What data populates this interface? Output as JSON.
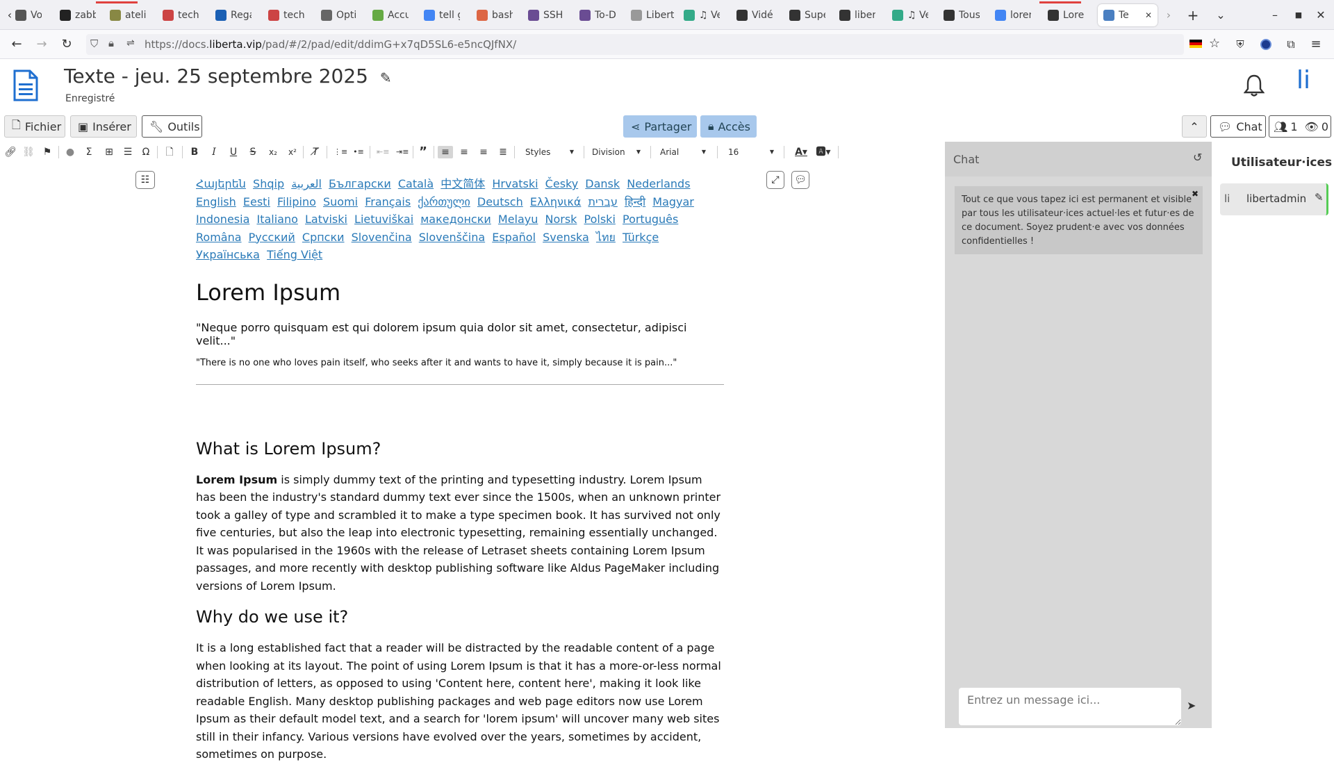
{
  "browser": {
    "tabs": [
      {
        "label": "Vork",
        "color": "#555"
      },
      {
        "label": "zabb",
        "color": "#222"
      },
      {
        "label": "ateli",
        "color": "#884"
      },
      {
        "label": "tech",
        "color": "#c44"
      },
      {
        "label": "Rega",
        "color": "#1a5fb4"
      },
      {
        "label": "tech",
        "color": "#c44"
      },
      {
        "label": "Optio",
        "color": "#666"
      },
      {
        "label": "Accu",
        "color": "#6a4"
      },
      {
        "label": "tell g",
        "color": "#4285f4"
      },
      {
        "label": "bash",
        "color": "#d64"
      },
      {
        "label": "SSH",
        "color": "#6a4c93"
      },
      {
        "label": "To-D",
        "color": "#6a4c93"
      },
      {
        "label": "Liberta",
        "color": "#999"
      },
      {
        "label": "♫ Ve",
        "color": "#3a8"
      },
      {
        "label": "Vidé",
        "color": "#333"
      },
      {
        "label": "Supe",
        "color": "#333"
      },
      {
        "label": "libert",
        "color": "#333"
      },
      {
        "label": "♫ Ve",
        "color": "#3a8"
      },
      {
        "label": "Tous",
        "color": "#333"
      },
      {
        "label": "loren",
        "color": "#4285f4"
      },
      {
        "label": "Lore",
        "color": "#333"
      },
      {
        "label": "Te",
        "color": "#4a7fc1"
      }
    ],
    "url_prefix": "https://docs.",
    "url_domain": "liberta.vip",
    "url_rest": "/pad/#/2/pad/edit/ddimG+x7qD5SL6-e5ncQJfNX/"
  },
  "app": {
    "title": "Texte - jeu. 25 septembre 2025",
    "status": "Enregistré",
    "user_initials": "li"
  },
  "toolbar": {
    "fichier": "Fichier",
    "inserer": "Insérer",
    "outils": "Outils",
    "partager": "Partager",
    "acces": "Accès",
    "chat": "Chat",
    "users_count": "1",
    "viewers_count": "0"
  },
  "format": {
    "styles": "Styles",
    "division": "Division",
    "font": "Arial",
    "size": "16"
  },
  "document": {
    "languages": [
      "Հայերեն",
      "Shqip",
      "العربية",
      "Български",
      "Català",
      "中文简体",
      "Hrvatski",
      "Česky",
      "Dansk",
      "Nederlands",
      "English",
      "Eesti",
      "Filipino",
      "Suomi",
      "Français",
      "ქართული",
      "Deutsch",
      "Ελληνικά",
      "עברית",
      "हिन्दी",
      "Magyar",
      "Indonesia",
      "Italiano",
      "Latviski",
      "Lietuviškai",
      "македонски",
      "Melayu",
      "Norsk",
      "Polski",
      "Português",
      "Româna",
      "Русский",
      "Српски",
      "Slovenčina",
      "Slovenščina",
      "Español",
      "Svenska",
      "ไทย",
      "Türkçe",
      "Українська",
      "Tiếng Việt"
    ],
    "heading": "Lorem Ipsum",
    "quote1": "\"Neque porro quisquam est qui dolorem ipsum quia dolor sit amet, consectetur, adipisci velit...\"",
    "quote2": "\"There is no one who loves pain itself, who seeks after it and wants to have it, simply because it is pain...\"",
    "h2_what": "What is Lorem Ipsum?",
    "what_bold": "Lorem Ipsum",
    "what_text": " is simply dummy text of the printing and typesetting industry. Lorem Ipsum has been the industry's standard dummy text ever since the 1500s, when an unknown printer took a galley of type and scrambled it to make a type specimen book. It has survived not only five centuries, but also the leap into electronic typesetting, remaining essentially unchanged. It was popularised in the 1960s with the release of Letraset sheets containing Lorem Ipsum passages, and more recently with desktop publishing software like Aldus PageMaker including versions of Lorem Ipsum.",
    "h2_why": "Why do we use it?",
    "why_text": "It is a long established fact that a reader will be distracted by the readable content of a page when looking at its layout. The point of using Lorem Ipsum is that it has a more-or-less normal distribution of letters, as opposed to using 'Content here, content here', making it look like readable English. Many desktop publishing packages and web page editors now use Lorem Ipsum as their default model text, and a search for 'lorem ipsum' will uncover many web sites still in their infancy. Various versions have evolved over the years, sometimes by accident, sometimes on purpose."
  },
  "chat": {
    "title": "Chat",
    "notice": "Tout ce que vous tapez ici est permanent et visible par tous les utilisateur·ices actuel·les et futur·es de ce document. Soyez prudent·e avec vos données confidentielles !",
    "input_placeholder": "Entrez un message ici..."
  },
  "users": {
    "title": "Utilisateur·ices",
    "list": [
      {
        "initials": "li",
        "name": "libertadmin"
      }
    ]
  }
}
